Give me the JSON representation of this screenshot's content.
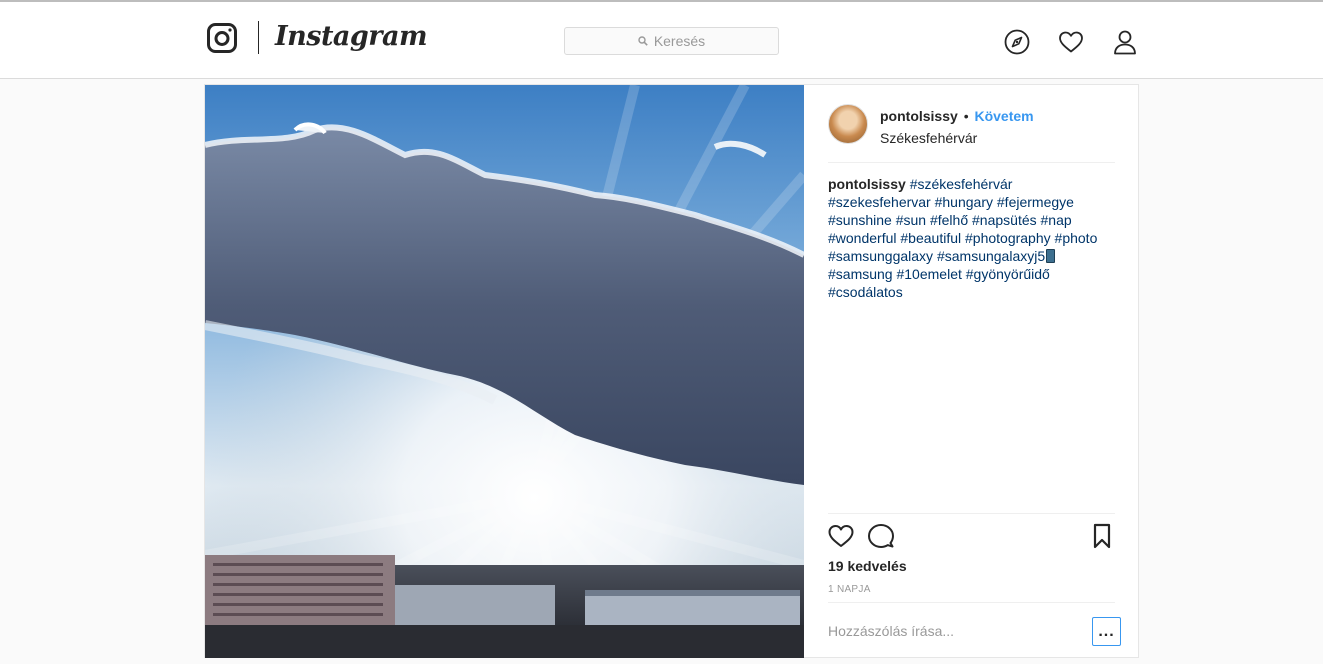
{
  "header": {
    "brand": "Instagram",
    "search_placeholder": "Keresés",
    "nav_icons": [
      "explore-icon",
      "heart-icon",
      "profile-icon"
    ]
  },
  "post": {
    "username": "pontolsissy",
    "separator": "•",
    "follow_label": "Követem",
    "location": "Székesfehérvár",
    "caption": {
      "username": "pontolsissy",
      "hashtags_before_emoji": [
        "#székesfehérvár",
        "#szekesfehervar",
        "#hungary",
        "#fejermegye",
        "#sunshine",
        "#sun",
        "#felhő",
        "#napsütés",
        "#nap",
        "#wonderful",
        "#beautiful",
        "#photography",
        "#photo",
        "#samsunggalaxy",
        "#samsungalaxyj5"
      ],
      "hashtags_after_emoji": [
        "#samsung",
        "#10emelet",
        "#gyönyörűidő",
        "#csodálatos"
      ]
    },
    "likes": "19 kedvelés",
    "time": "1 NAPJA",
    "comment_placeholder": "Hozzászólás írása...",
    "more_label": "..."
  },
  "colors": {
    "accent": "#3897f0",
    "hashtag": "#003569",
    "muted": "#999999",
    "border": "#dbdbdb"
  }
}
